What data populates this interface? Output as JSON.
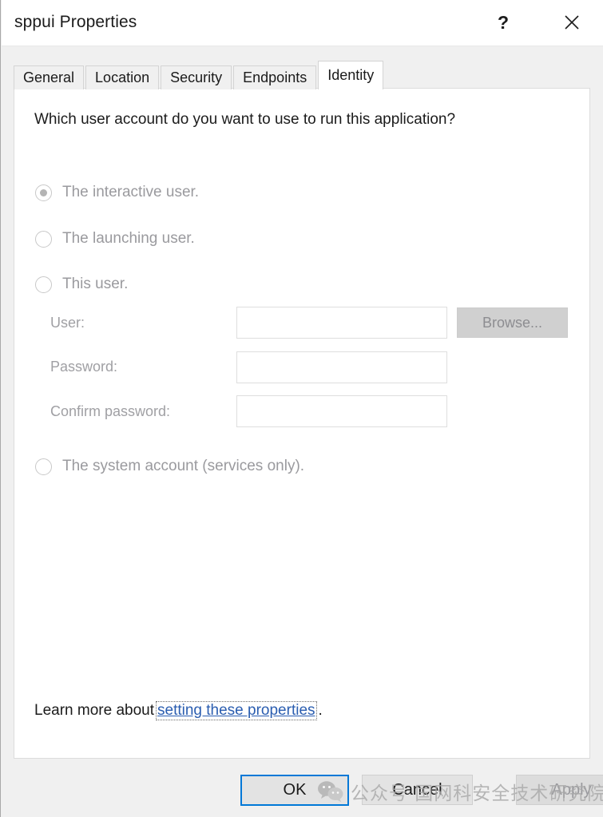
{
  "window": {
    "title": "sppui Properties",
    "help_icon": "question-mark-icon",
    "help_label": "?",
    "close_icon": "close-icon"
  },
  "tabs": [
    {
      "label": "General",
      "active": false
    },
    {
      "label": "Location",
      "active": false
    },
    {
      "label": "Security",
      "active": false
    },
    {
      "label": "Endpoints",
      "active": false
    },
    {
      "label": "Identity",
      "active": true
    }
  ],
  "identity_panel": {
    "question": "Which user account do you want to use to run this application?",
    "options": [
      {
        "label": "The interactive user.",
        "checked": true,
        "disabled": true
      },
      {
        "label": "The launching user.",
        "checked": false,
        "disabled": true
      },
      {
        "label": "This user.",
        "checked": false,
        "disabled": true
      },
      {
        "label": "The system account (services only).",
        "checked": false,
        "disabled": true
      }
    ],
    "fields": [
      {
        "label": "User:",
        "value": "",
        "placeholder": ""
      },
      {
        "label": "Password:",
        "value": "",
        "placeholder": ""
      },
      {
        "label": "Confirm password:",
        "value": "",
        "placeholder": ""
      }
    ],
    "browse_label": "Browse...",
    "learn_more_prefix": "Learn more about",
    "learn_more_link": "setting these properties",
    "learn_more_suffix": "."
  },
  "footer": {
    "ok_label": "OK",
    "cancel_label": "Cancel",
    "apply_label": "Apply"
  },
  "watermark": {
    "icon": "wechat-icon",
    "text": "公众号 国网科安全技术研究院"
  },
  "colors": {
    "accent": "#0078d7",
    "link": "#2a5db0",
    "dialog_bg": "#f0f0f0",
    "panel_bg": "#ffffff",
    "disabled_text": "#9a9a9e"
  }
}
